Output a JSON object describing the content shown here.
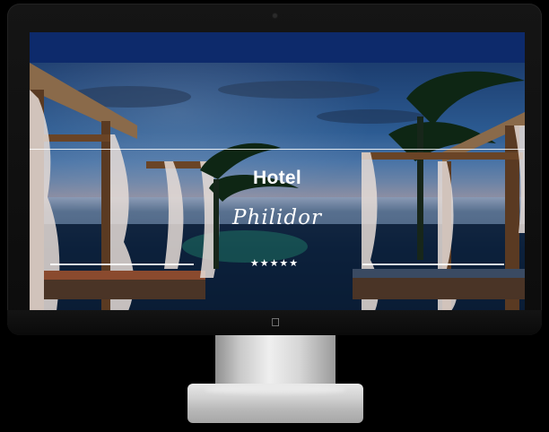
{
  "hero": {
    "title": "Hotel",
    "name": "Philidor",
    "rating_stars": 5,
    "stars_text": "★★★★★"
  },
  "icons": {
    "camera": "camera-icon",
    "apple": "apple-logo-icon",
    "star": "star-icon"
  },
  "colors": {
    "nav_bar": "#0d2a6b",
    "text": "#ffffff",
    "monitor_bezel": "#111111",
    "stand_silver": "#d2d2d2"
  }
}
